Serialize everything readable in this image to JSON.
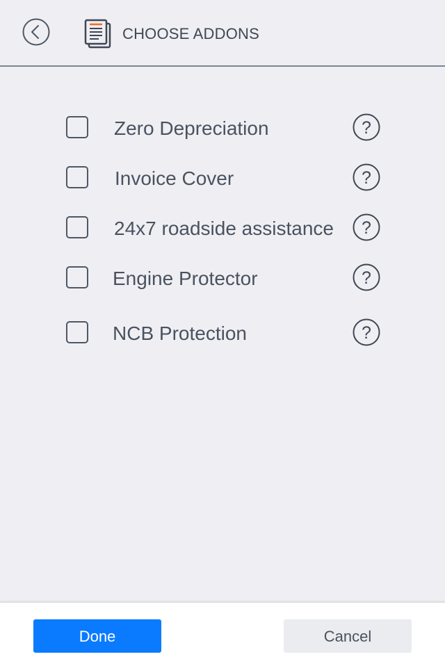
{
  "header": {
    "title": "CHOOSE ADDONS",
    "back_icon": "chevron-left-circle-icon",
    "doc_icon": "document-icon"
  },
  "addons": [
    {
      "label": "Zero Depreciation",
      "checked": false,
      "help_icon": "question-circle-icon"
    },
    {
      "label": "Invoice Cover",
      "checked": false,
      "help_icon": "question-circle-icon"
    },
    {
      "label": "24x7 roadside assistance",
      "checked": false,
      "help_icon": "question-circle-icon"
    },
    {
      "label": "Engine Protector",
      "checked": false,
      "help_icon": "question-circle-icon"
    },
    {
      "label": "NCB Protection",
      "checked": false,
      "help_icon": "question-circle-icon"
    }
  ],
  "footer": {
    "done_label": "Done",
    "cancel_label": "Cancel"
  },
  "colors": {
    "background": "#efeff3",
    "primary": "#0a7bff",
    "accent_orange": "#f26b21",
    "text": "#4a5260"
  }
}
